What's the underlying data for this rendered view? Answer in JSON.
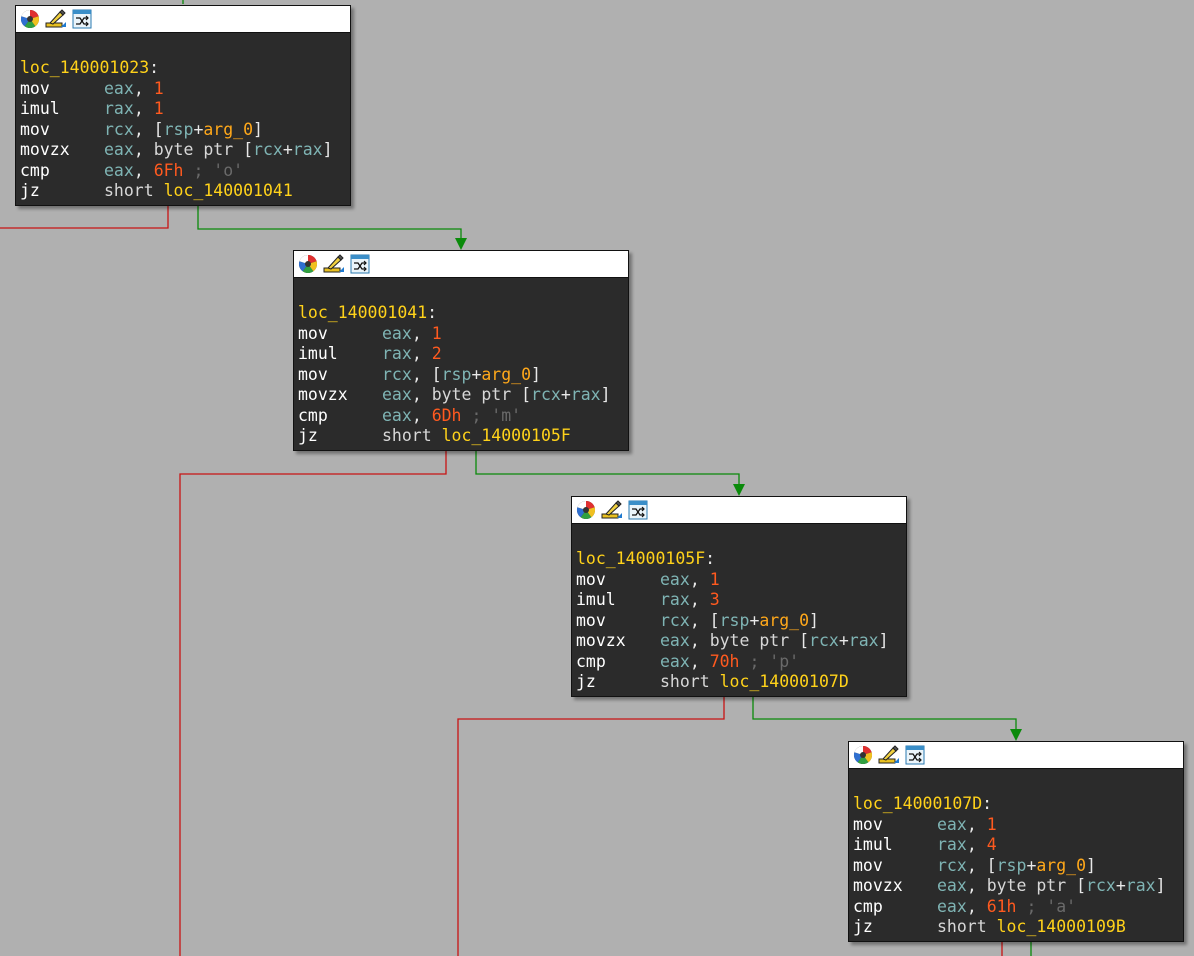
{
  "colors": {
    "background": "#b0b0b0",
    "node_bg": "#2b2b2b",
    "true_edge": "#0a8a0a",
    "false_edge": "#c81414",
    "label": "#ffd21a",
    "register": "#7fb4b4",
    "number": "#ff5a1f",
    "arg": "#ffa81a",
    "comment": "#6a6a6a"
  },
  "header_icons": [
    "color-palette-icon",
    "edit-pencil-icon",
    "graph-switch-icon"
  ],
  "blocks": [
    {
      "label": "loc_140001023",
      "lines": [
        {
          "mnemonic": "mov",
          "dst": "eax",
          "src_num": "1"
        },
        {
          "mnemonic": "imul",
          "dst": "rax",
          "src_num": "1"
        },
        {
          "mnemonic": "mov",
          "dst": "rcx",
          "mem_base": "rsp",
          "mem_arg": "arg_0"
        },
        {
          "mnemonic": "movzx",
          "dst": "eax",
          "ptr_kw": "byte ptr",
          "mem_r1": "rcx",
          "mem_r2": "rax"
        },
        {
          "mnemonic": "cmp",
          "dst": "eax",
          "src_num": "6Fh",
          "comment": "; 'o'"
        },
        {
          "mnemonic": "jz",
          "kw": "short",
          "target": "loc_140001041"
        }
      ]
    },
    {
      "label": "loc_140001041",
      "lines": [
        {
          "mnemonic": "mov",
          "dst": "eax",
          "src_num": "1"
        },
        {
          "mnemonic": "imul",
          "dst": "rax",
          "src_num": "2"
        },
        {
          "mnemonic": "mov",
          "dst": "rcx",
          "mem_base": "rsp",
          "mem_arg": "arg_0"
        },
        {
          "mnemonic": "movzx",
          "dst": "eax",
          "ptr_kw": "byte ptr",
          "mem_r1": "rcx",
          "mem_r2": "rax"
        },
        {
          "mnemonic": "cmp",
          "dst": "eax",
          "src_num": "6Dh",
          "comment": "; 'm'"
        },
        {
          "mnemonic": "jz",
          "kw": "short",
          "target": "loc_14000105F"
        }
      ]
    },
    {
      "label": "loc_14000105F",
      "lines": [
        {
          "mnemonic": "mov",
          "dst": "eax",
          "src_num": "1"
        },
        {
          "mnemonic": "imul",
          "dst": "rax",
          "src_num": "3"
        },
        {
          "mnemonic": "mov",
          "dst": "rcx",
          "mem_base": "rsp",
          "mem_arg": "arg_0"
        },
        {
          "mnemonic": "movzx",
          "dst": "eax",
          "ptr_kw": "byte ptr",
          "mem_r1": "rcx",
          "mem_r2": "rax"
        },
        {
          "mnemonic": "cmp",
          "dst": "eax",
          "src_num": "70h",
          "comment": "; 'p'"
        },
        {
          "mnemonic": "jz",
          "kw": "short",
          "target": "loc_14000107D"
        }
      ]
    },
    {
      "label": "loc_14000107D",
      "lines": [
        {
          "mnemonic": "mov",
          "dst": "eax",
          "src_num": "1"
        },
        {
          "mnemonic": "imul",
          "dst": "rax",
          "src_num": "4"
        },
        {
          "mnemonic": "mov",
          "dst": "rcx",
          "mem_base": "rsp",
          "mem_arg": "arg_0"
        },
        {
          "mnemonic": "movzx",
          "dst": "eax",
          "ptr_kw": "byte ptr",
          "mem_r1": "rcx",
          "mem_r2": "rax"
        },
        {
          "mnemonic": "cmp",
          "dst": "eax",
          "src_num": "61h",
          "comment": "; 'a'"
        },
        {
          "mnemonic": "jz",
          "kw": "short",
          "target": "loc_14000109B"
        }
      ]
    }
  ]
}
